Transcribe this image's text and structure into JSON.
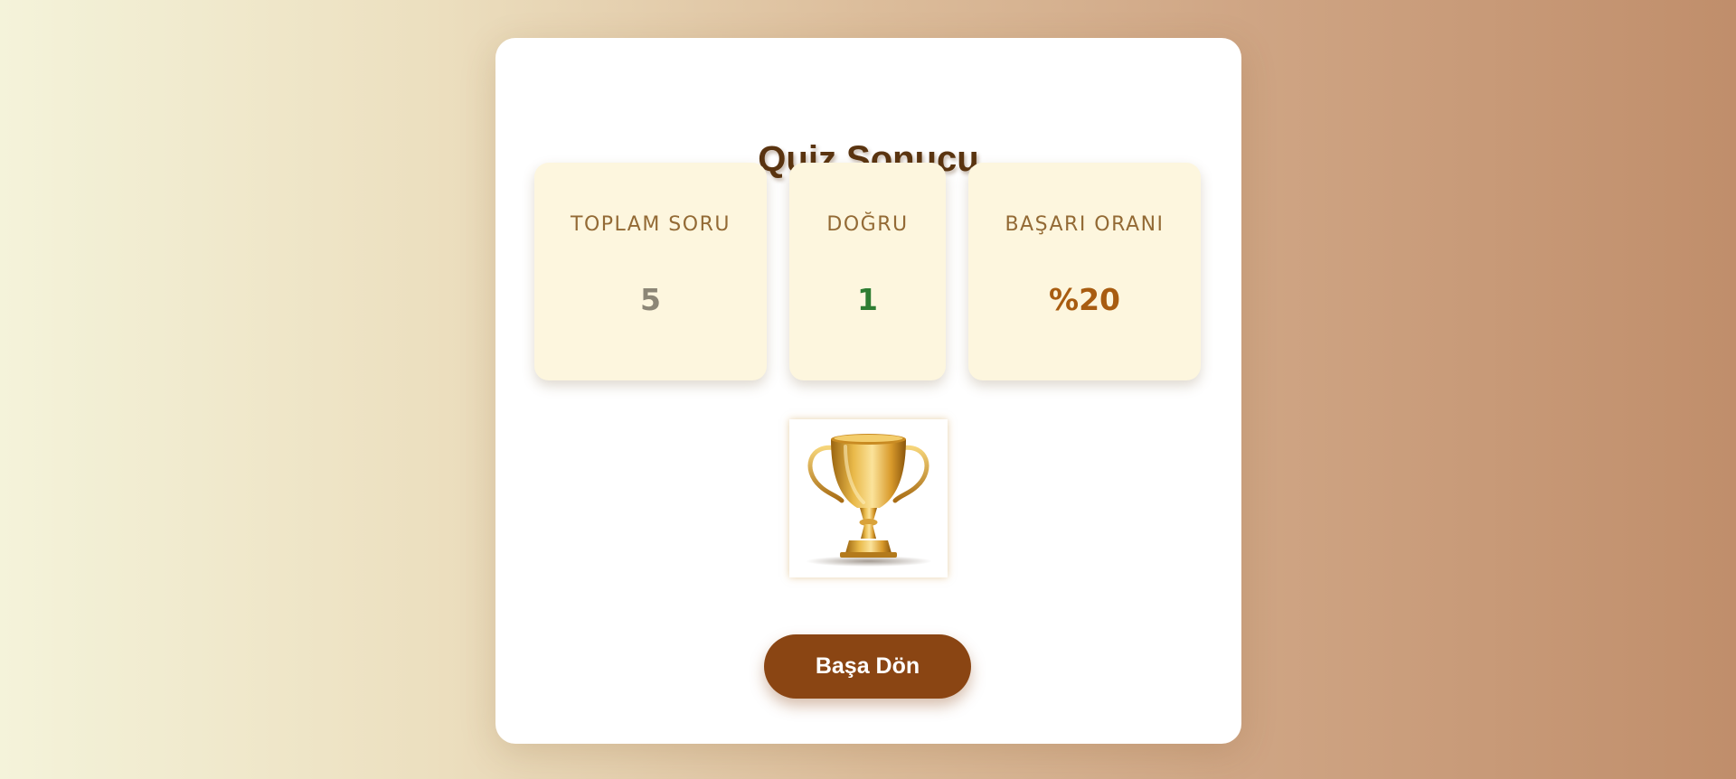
{
  "quiz_result": {
    "title": "Quiz Sonucu",
    "stats": {
      "total": {
        "label": "TOPLAM SORU",
        "value": "5",
        "value_color": "#8c8676"
      },
      "correct": {
        "label": "DOĞRU",
        "value": "1",
        "value_color": "#2e7d32"
      },
      "rate": {
        "label": "BAŞARI ORANI",
        "value": "%20",
        "value_color": "#a85c10"
      }
    },
    "trophy_icon": "trophy-icon",
    "back_button_label": "Başa Dön"
  },
  "colors": {
    "accent": "#8a4513",
    "title": "#5a3410",
    "stat_card_bg": "#fdf6de",
    "stat_label": "#936a35"
  }
}
